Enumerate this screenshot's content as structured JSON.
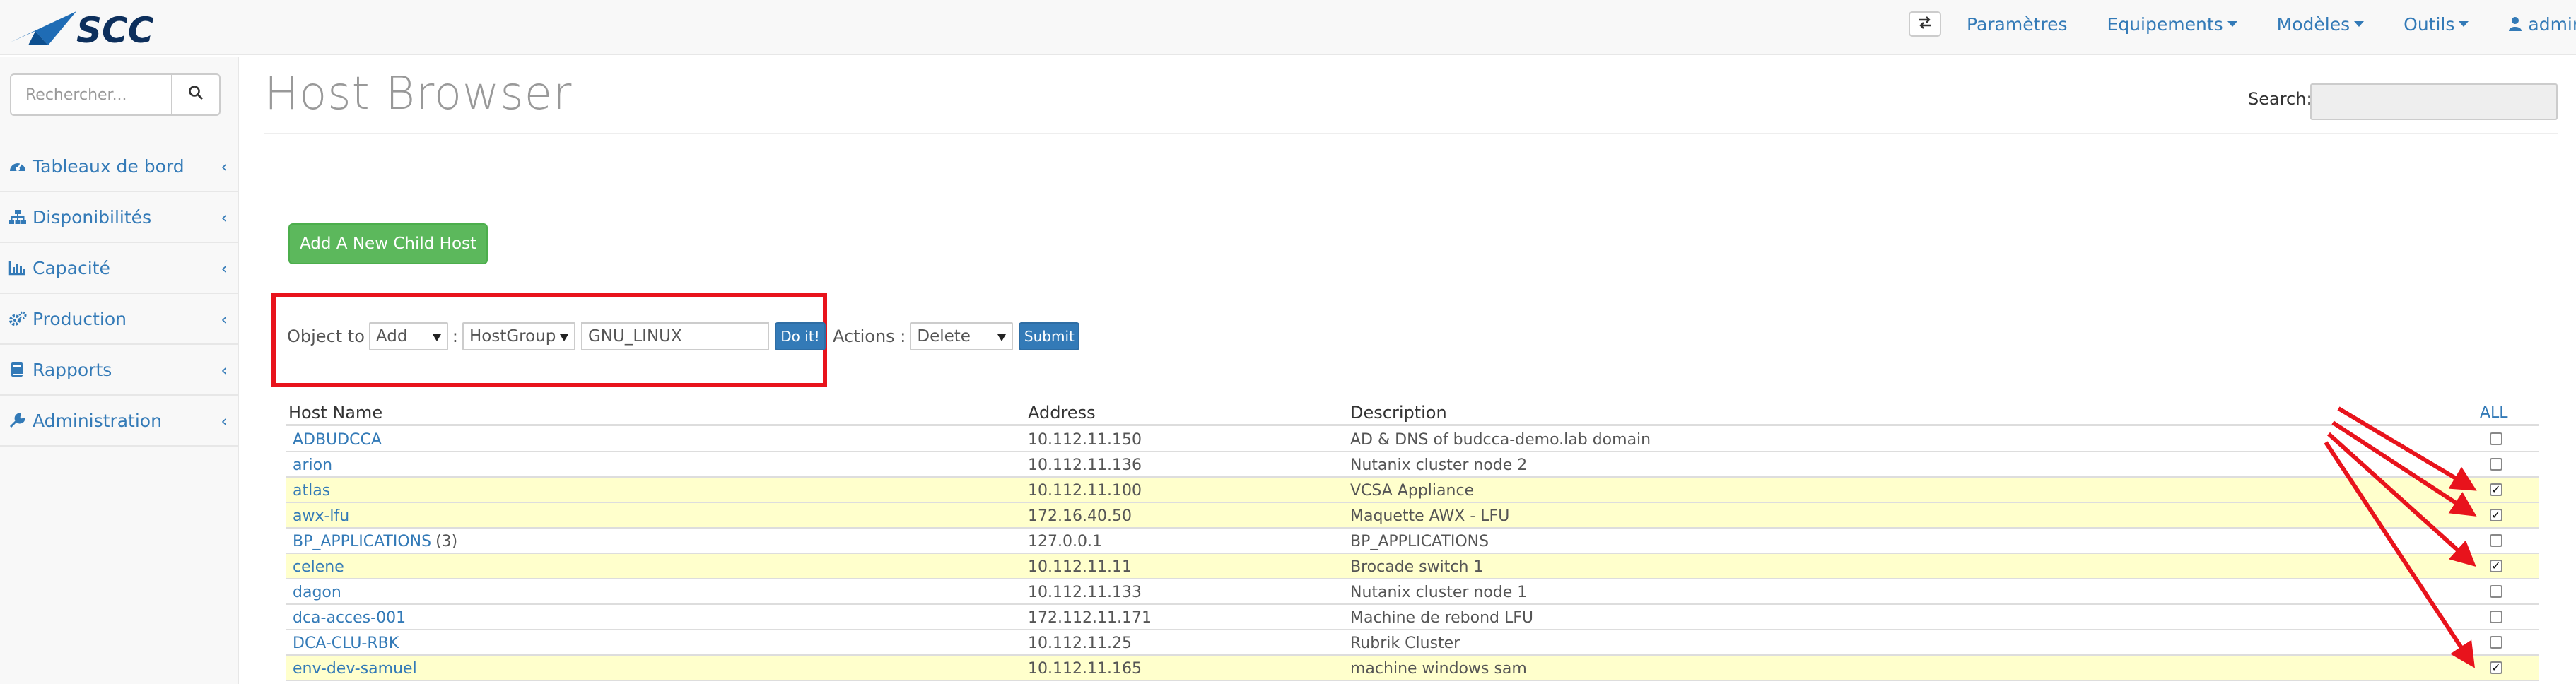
{
  "brand": {
    "logo_text": "SCC",
    "logo_color": "#1f6cb5",
    "accent": "#337ab7"
  },
  "navbar": {
    "toggle_icon": "exchange-icon",
    "items": [
      {
        "label": "Paramètres",
        "dropdown": false
      },
      {
        "label": "Equipements",
        "dropdown": true
      },
      {
        "label": "Modèles",
        "dropdown": true
      },
      {
        "label": "Outils",
        "dropdown": true
      },
      {
        "label": "admin",
        "dropdown": true,
        "icon": "user-icon"
      }
    ]
  },
  "sidebar": {
    "search_placeholder": "Rechercher...",
    "items": [
      {
        "label": "Tableaux de bord",
        "icon": "dashboard-icon"
      },
      {
        "label": "Disponibilités",
        "icon": "sitemap-icon"
      },
      {
        "label": "Capacité",
        "icon": "bar-chart-icon"
      },
      {
        "label": "Production",
        "icon": "cogs-icon"
      },
      {
        "label": "Rapports",
        "icon": "book-icon"
      },
      {
        "label": "Administration",
        "icon": "wrench-icon"
      }
    ]
  },
  "main": {
    "title": "Host Browser",
    "search_label": "Search:",
    "search_value": "",
    "add_child_button": "Add A New Child Host",
    "object_form": {
      "label": "Object to",
      "action_select": "Add",
      "separator": ":",
      "type_select": "HostGroup",
      "value_input": "GNU_LINUX",
      "do_button": "Do it!",
      "actions_label": "Actions :",
      "actions_select": "Delete",
      "submit_button": "Submit"
    },
    "table": {
      "headers": {
        "name": "Host Name",
        "address": "Address",
        "description": "Description",
        "all": "ALL"
      },
      "rows": [
        {
          "name": "ADBUDCCA",
          "count": "",
          "address": "10.112.11.150",
          "description": "AD & DNS of budcca-demo.lab domain",
          "checked": false,
          "highlight": false
        },
        {
          "name": "arion",
          "count": "",
          "address": "10.112.11.136",
          "description": "Nutanix cluster node 2",
          "checked": false,
          "highlight": false
        },
        {
          "name": "atlas",
          "count": "",
          "address": "10.112.11.100",
          "description": "VCSA Appliance",
          "checked": true,
          "highlight": true
        },
        {
          "name": "awx-lfu",
          "count": "",
          "address": "172.16.40.50",
          "description": "Maquette AWX - LFU",
          "checked": true,
          "highlight": true
        },
        {
          "name": "BP_APPLICATIONS",
          "count": "(3)",
          "address": "127.0.0.1",
          "description": "BP_APPLICATIONS",
          "checked": false,
          "highlight": false
        },
        {
          "name": "celene",
          "count": "",
          "address": "10.112.11.11",
          "description": "Brocade switch 1",
          "checked": true,
          "highlight": true
        },
        {
          "name": "dagon",
          "count": "",
          "address": "10.112.11.133",
          "description": "Nutanix cluster node 1",
          "checked": false,
          "highlight": false
        },
        {
          "name": "dca-acces-001",
          "count": "",
          "address": "172.112.11.171",
          "description": "Machine de rebond LFU",
          "checked": false,
          "highlight": false
        },
        {
          "name": "DCA-CLU-RBK",
          "count": "",
          "address": "10.112.11.25",
          "description": "Rubrik Cluster",
          "checked": false,
          "highlight": false
        },
        {
          "name": "env-dev-samuel",
          "count": "",
          "address": "10.112.11.165",
          "description": "machine windows sam",
          "checked": true,
          "highlight": true
        }
      ]
    }
  },
  "annotations": {
    "color": "#e8131c",
    "highlight_row_color": "#ffffcc"
  }
}
